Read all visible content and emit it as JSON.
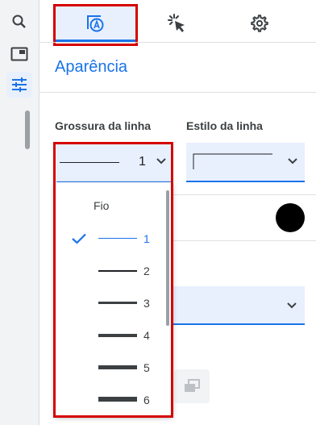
{
  "tabs": [
    {
      "name": "appearance",
      "icon": "shape-text-icon"
    },
    {
      "name": "interaction",
      "icon": "click-icon"
    },
    {
      "name": "settings",
      "icon": "gear-icon"
    }
  ],
  "rail": [
    "search-icon",
    "picture-in-picture-icon",
    "tune-icon"
  ],
  "section_title": "Aparência",
  "line_width": {
    "label": "Grossura da linha",
    "value": "1",
    "options": [
      {
        "label": "Fio",
        "selected": false
      },
      {
        "label": "1",
        "selected": true
      },
      {
        "label": "2",
        "selected": false
      },
      {
        "label": "3",
        "selected": false
      },
      {
        "label": "4",
        "selected": false
      },
      {
        "label": "5",
        "selected": false
      },
      {
        "label": "6",
        "selected": false
      }
    ]
  },
  "line_style": {
    "label": "Estilo da linha"
  },
  "colors": {
    "accent": "#1a73e8",
    "highlight": "#d50000",
    "swatch": "#000000"
  }
}
